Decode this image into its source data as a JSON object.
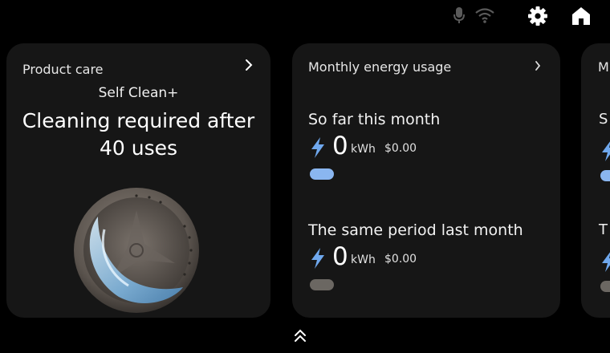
{
  "cards": {
    "product_care": {
      "title": "Product care",
      "subtitle": "Self Clean+",
      "message_line1": "Cleaning required after",
      "message_line2": "40 uses"
    },
    "energy": {
      "title": "Monthly energy usage",
      "this_month": {
        "label": "So far this month",
        "value": "0",
        "unit": "kWh",
        "cost": "$0.00"
      },
      "last_month": {
        "label": "The same period last month",
        "value": "0",
        "unit": "kWh",
        "cost": "$0.00"
      }
    },
    "third": {
      "title_fragment": "M",
      "label1_fragment": "S",
      "label2_fragment": "T"
    }
  },
  "icons": {
    "mic": "microphone-icon",
    "wifi": "wifi-icon",
    "settings": "gear-icon",
    "home": "home-icon",
    "card_arrow": "chevron-right-icon",
    "bolt": "lightning-bolt-icon",
    "expand": "double-chevron-up-icon"
  },
  "colors": {
    "background": "#000000",
    "card": "#161616",
    "accent_blue": "#8ab6f0",
    "bolt_blue": "#6fa8ee",
    "muted_gray": "#6b6762"
  }
}
